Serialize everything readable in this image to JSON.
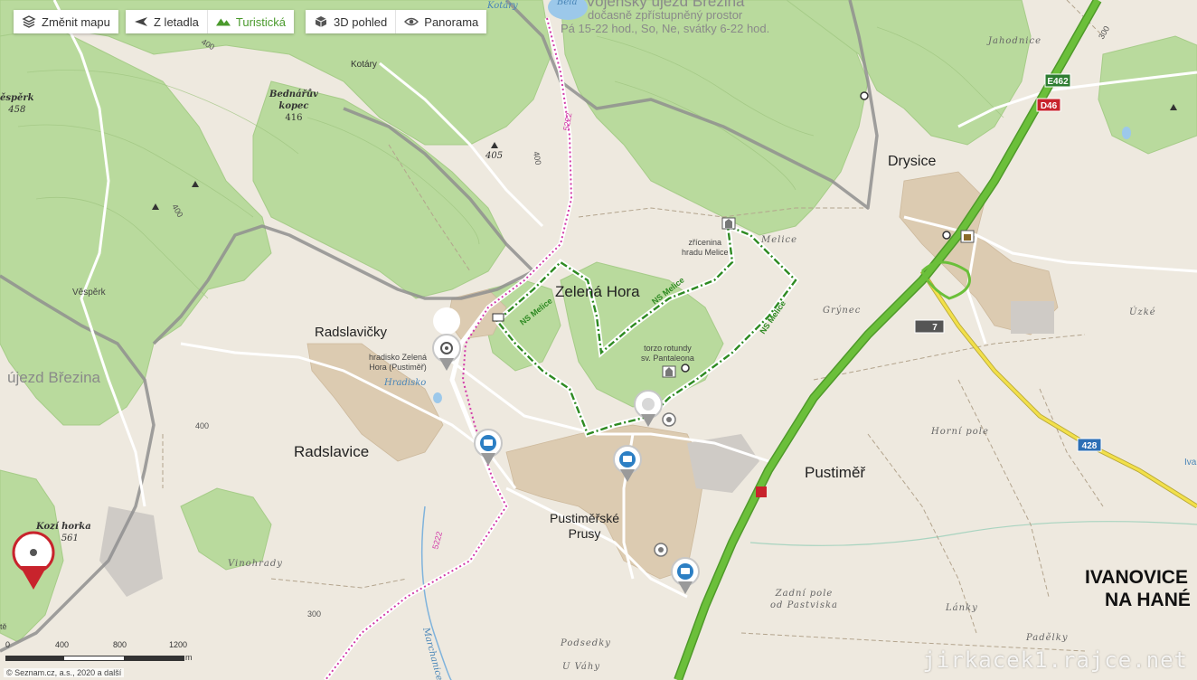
{
  "toolbar": {
    "change_map": "Změnit mapu",
    "aerial": "Z letadla",
    "tourist": "Turistická",
    "view3d": "3D pohled",
    "panorama": "Panorama",
    "active": "tourist"
  },
  "labels": {
    "military_title": "Vojenský újezd Březina",
    "military_line1": "dočasně zpřístupněný prostor",
    "military_line2": "Pá 15-22 hod., So, Ne, svátky 6-22 hod.",
    "ujezd": "újezd Březina",
    "kotary_water": "Kotáry",
    "bela": "Bělá",
    "kotary": "Kotáry",
    "jahodnice": "Jahodnice",
    "drysice": "Drysice",
    "zelena_hora": "Zelená Hora",
    "radslavicky": "Radslavičky",
    "radslavice": "Radslavice",
    "pustimer": "Pustiměř",
    "pustimerske_1": "Pustiměřské",
    "pustimerske_2": "Prusy",
    "ivanovice_1": "IVANOVICE",
    "ivanovice_2": "NA HANÉ",
    "bednaruv_1": "Bednářův",
    "bednaruv_2": "kopec",
    "bednaruv_alt": "416",
    "alt_405": "405",
    "alt_400a": "400",
    "alt_400b": "400",
    "alt_400c": "400",
    "alt_400d": "400",
    "alt_300a": "300",
    "alt_300b": "300",
    "alt_458": "458",
    "vesperk_top": "ěspěrk",
    "vesperk": "Věspěrk",
    "kozi_horka": "Kozí horka",
    "kozi_alt": "561",
    "zricenina_1": "zřícenina",
    "zricenina_2": "hradu Melice",
    "torzo_1": "torzo rotundy",
    "torzo_2": "sv. Pantaleona",
    "hradisko_1": "hradisko Zelená",
    "hradisko_2": "Hora (Pustiměř)",
    "hradisko_field": "Hradisko",
    "melice": "Melice",
    "grynec": "Grýnec",
    "uzke": "Úzké",
    "horni_pole": "Horní pole",
    "vinohrady": "Vinohrady",
    "zadni_1": "Zadní pole",
    "zadni_2": "od Pastviska",
    "lanky": "Lánky",
    "padelky": "Padělky",
    "podsedky": "Podsedky",
    "u_vahy": "U Váhy",
    "marchanice": "Marchanice",
    "ns_melice": "NS Melice",
    "bike_5222": "5222",
    "ivaz_edge": "Iva",
    "te_edge": "tě"
  },
  "shields": {
    "e462": "E462",
    "d46": "D46",
    "r428": "428",
    "exit7": "7"
  },
  "scale": {
    "t0": "0",
    "t400": "400",
    "t800": "800",
    "t1200": "1200",
    "unit": "m"
  },
  "copyright": "© Seznam.cz, a.s., 2020 a další",
  "watermark": "jirkacek1.rajce.net",
  "colors": {
    "forest": "#b7d99a",
    "forest_dark": "#9ec77e",
    "meadow": "#eee9df",
    "urban": "#dccbb1",
    "motorway": "#6bbf3a",
    "road_yellow": "#f2e04a",
    "military_border": "#8f8f8f",
    "trail_green": "#2e8a22",
    "bike_pink": "#d23aa8",
    "water": "#9cc8ea",
    "brand_red": "#c8232c"
  }
}
